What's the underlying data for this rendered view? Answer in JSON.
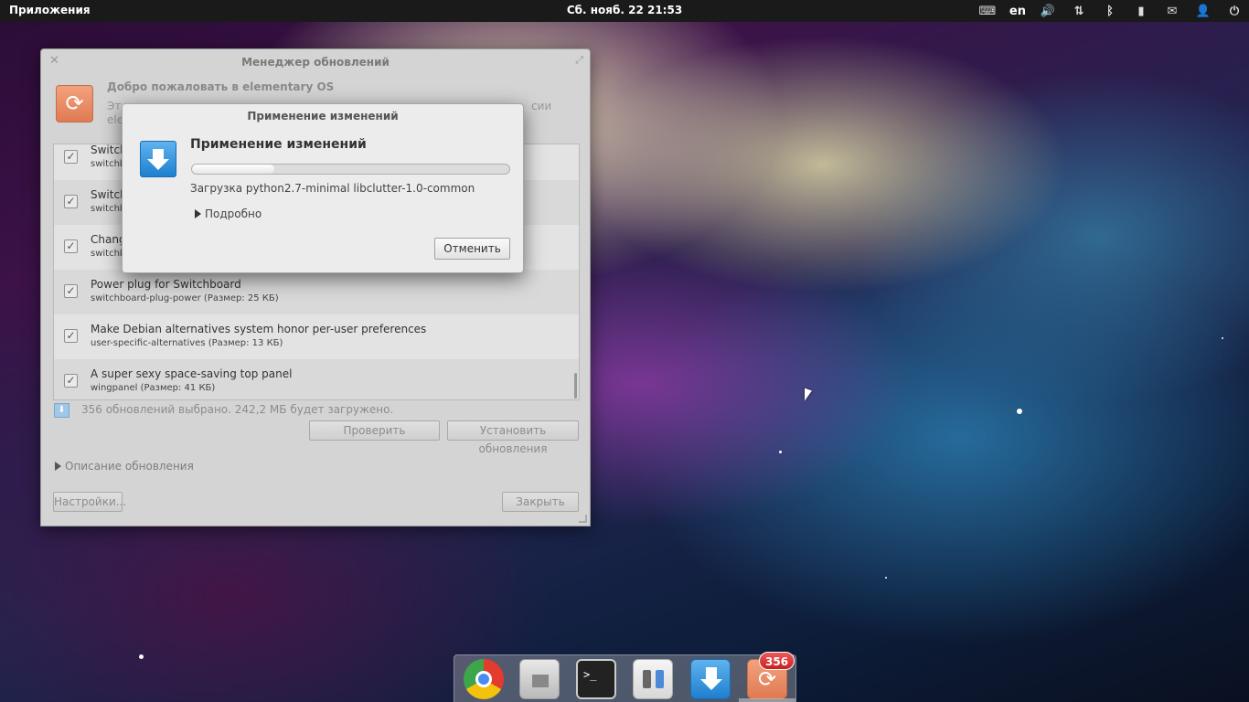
{
  "top_panel": {
    "apps_label": "Приложения",
    "clock": "Сб. нояб. 22 21:53",
    "language": "en",
    "indicators": [
      "keyboard-icon",
      "volume-icon",
      "network-icon",
      "bluetooth-icon",
      "battery-icon",
      "mail-icon",
      "user-icon",
      "power-icon"
    ]
  },
  "update_manager": {
    "title": "Менеджер обновлений",
    "welcome_title": "Добро пожаловать в elementary OS",
    "welcome_desc_line1": "Эт",
    "welcome_desc_line2": "ele",
    "welcome_desc_tail": "сии",
    "packages": [
      {
        "title": "Switch",
        "subtitle": "switchb",
        "checked": true
      },
      {
        "title": "Switch",
        "subtitle": "switchb",
        "checked": true
      },
      {
        "title": "Chang",
        "subtitle": "switchb",
        "checked": true
      },
      {
        "title": "Power plug for Switchboard",
        "subtitle": "switchboard-plug-power (Размер: 25 КБ)",
        "checked": true
      },
      {
        "title": "Make Debian alternatives system honor per-user preferences",
        "subtitle": "user-specific-alternatives (Размер: 13 КБ)",
        "checked": true
      },
      {
        "title": "A super sexy space-saving top panel",
        "subtitle": "wingpanel (Размер: 41 КБ)",
        "checked": true
      }
    ],
    "selection_status": "356 обновлений выбрано. 242,2 МБ будет загружено.",
    "check_button": "Проверить",
    "install_button": "Установить обновления",
    "description_toggle": "Описание обновления",
    "settings_button": "Настройки...",
    "close_button": "Закрыть"
  },
  "apply_dialog": {
    "title": "Применение изменений",
    "heading": "Применение изменений",
    "progress": 0.26,
    "status": "Загрузка python2.7-minimal libclutter-1.0-common",
    "details_toggle": "Подробно",
    "cancel_button": "Отменить"
  },
  "dock": {
    "items": [
      "chrome-icon",
      "files-icon",
      "terminal-icon",
      "switchboard-icon",
      "installer-icon",
      "update-manager-icon"
    ],
    "terminal_prompt": ">_",
    "update_badge": "356"
  },
  "colors": {
    "panel": "#1a1a1a",
    "accent_blue": "#1f7fcf",
    "updater_orange": "#e07a52",
    "badge_red": "#c81e1e"
  }
}
